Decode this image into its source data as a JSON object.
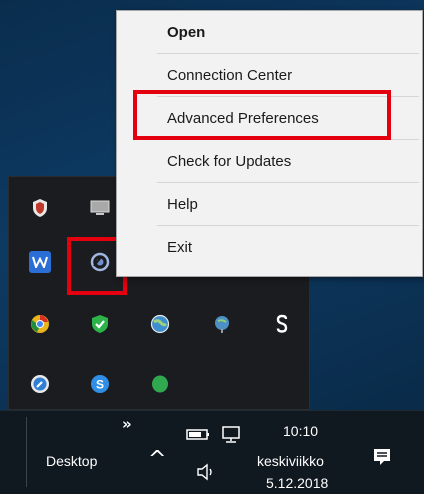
{
  "context_menu": {
    "items": [
      {
        "label": "Open",
        "bold": true
      },
      {
        "label": "Connection Center",
        "bold": false
      },
      {
        "label": "Advanced Preferences",
        "bold": false,
        "highlighted": true
      },
      {
        "label": "Check for Updates",
        "bold": false
      },
      {
        "label": "Help",
        "bold": false
      },
      {
        "label": "Exit",
        "bold": false
      }
    ]
  },
  "tray_panel": {
    "icons": [
      {
        "name": "security-shield-icon",
        "color": "#c0392b"
      },
      {
        "name": "monitor-icon",
        "color": "#c8c8c8"
      },
      {
        "name": "word-icon",
        "color": "#2b6fd6"
      },
      {
        "name": "citrix-receiver-icon",
        "color": "#8fa8d8",
        "highlighted": true
      },
      {
        "name": "green-app-icon",
        "color": "#2e9b3e"
      },
      {
        "name": "pen-icon",
        "color": "#d9d9d9"
      },
      {
        "name": "chrome-icon",
        "color": "#e0a020"
      },
      {
        "name": "green-check-shield-icon",
        "color": "#2eb34a"
      },
      {
        "name": "globe-icon",
        "color": "#5aa0d6"
      },
      {
        "name": "network-globe-icon",
        "color": "#4e8fc4"
      },
      {
        "name": "dollar-icon",
        "color": "#ffffff"
      },
      {
        "name": "wrench-icon",
        "color": "#5aa0e6"
      },
      {
        "name": "skype-icon",
        "color": "#2f8ee6"
      },
      {
        "name": "evernote-icon",
        "color": "#2fa84f"
      }
    ]
  },
  "taskbar": {
    "overflow_chevron": "»",
    "desktop_label": "Desktop",
    "show_hidden_icons": "^",
    "time": "10:10",
    "day": "keskiviikko",
    "date": "5.12.2018"
  },
  "colors": {
    "highlight": "#e4000f",
    "menu_bg": "#f2f2f2",
    "taskbar_bg": "#101820",
    "tray_bg": "#1b1c1f"
  }
}
